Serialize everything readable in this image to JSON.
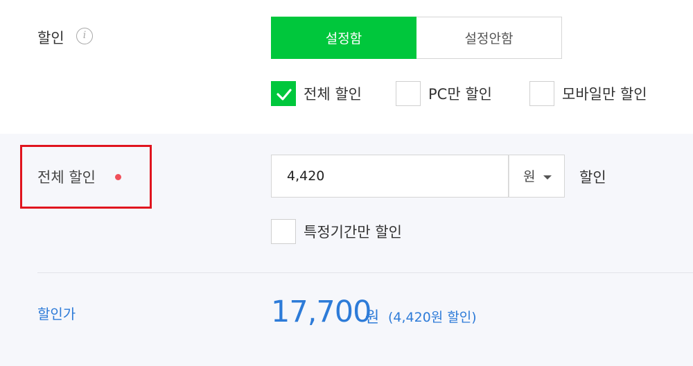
{
  "discount": {
    "label": "할인",
    "info_icon": "i",
    "toggle": {
      "on_label": "설정함",
      "off_label": "설정안함",
      "selected": "설정함"
    },
    "scope_options": [
      {
        "label": "전체 할인",
        "checked": true
      },
      {
        "label": "PC만 할인",
        "checked": false
      },
      {
        "label": "모바일만 할인",
        "checked": false
      }
    ]
  },
  "full_discount": {
    "label": "전체 할인",
    "amount_value": "4,420",
    "unit": "원",
    "suffix": "할인",
    "period_option": {
      "label": "특정기간만 할인",
      "checked": false
    }
  },
  "sale_price": {
    "label": "할인가",
    "amount": "17,700",
    "unit": "원",
    "note": "(4,420원 할인)"
  },
  "colors": {
    "green": "#00c73c",
    "blue": "#2d7bd8",
    "highlight_red": "#e0141e"
  }
}
